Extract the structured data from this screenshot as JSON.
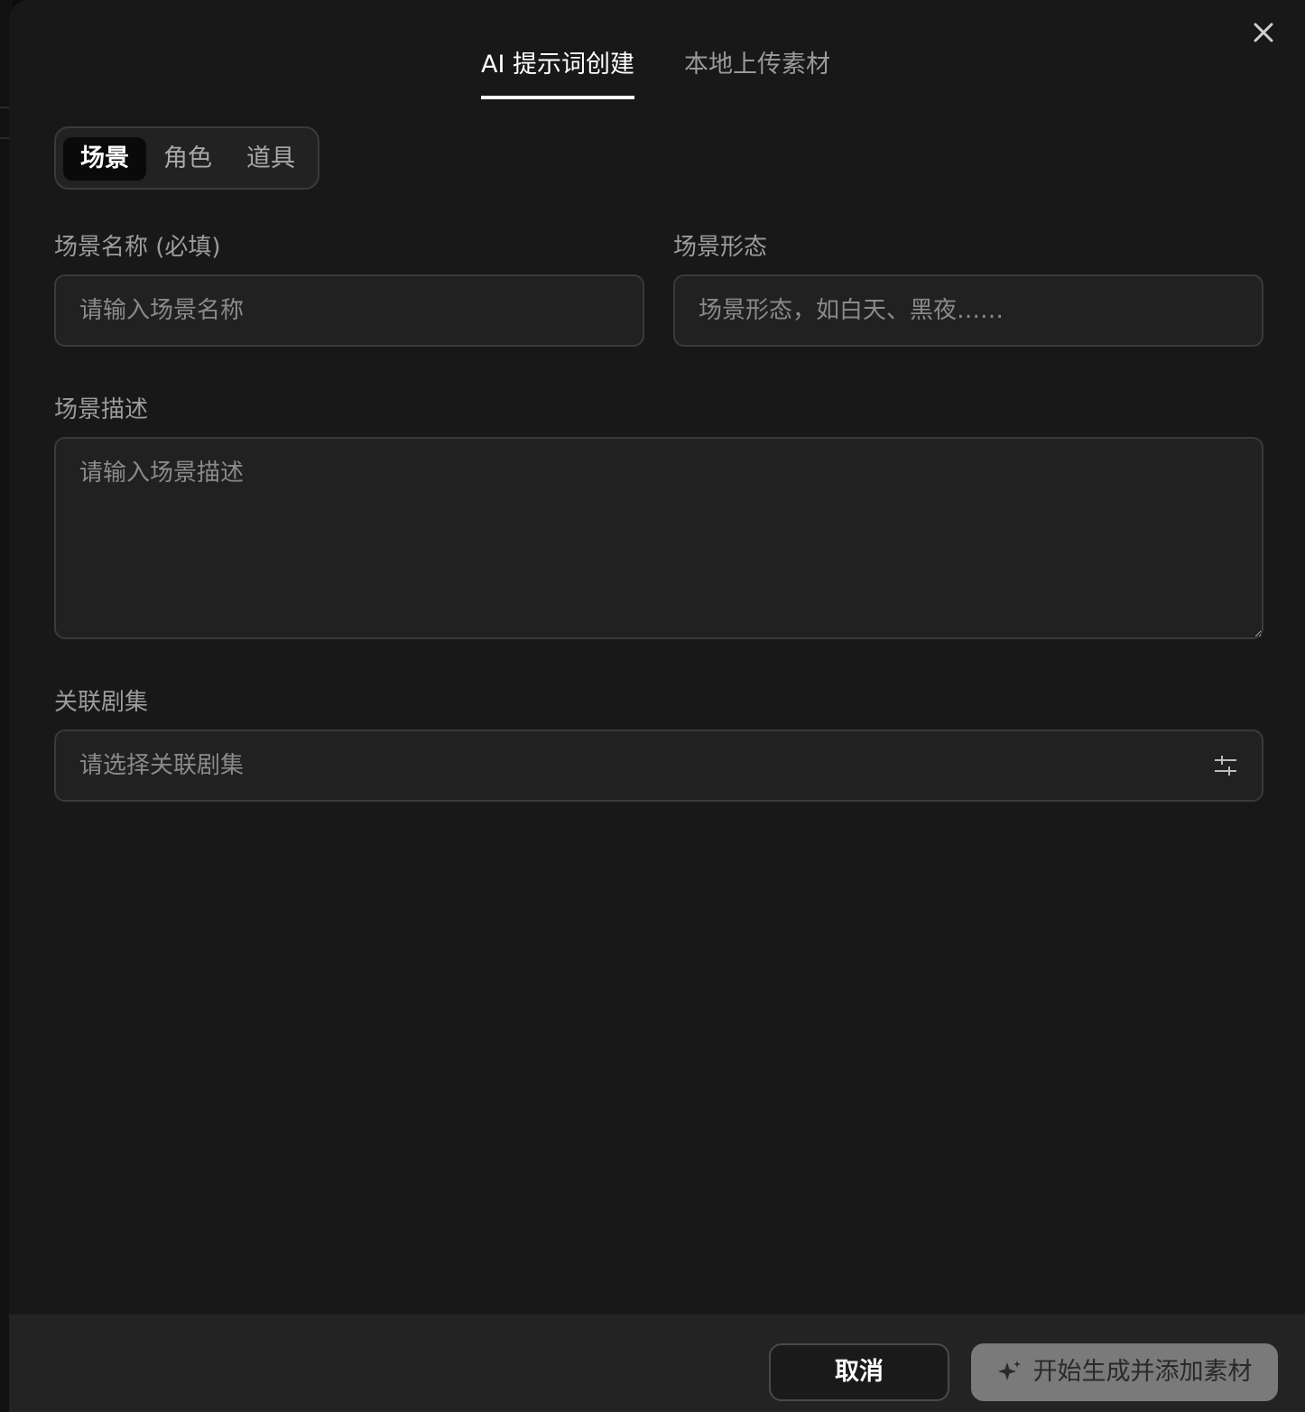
{
  "tabs": {
    "ai_create": "AI 提示词创建",
    "local_upload": "本地上传素材"
  },
  "segments": [
    {
      "label": "场景",
      "active": true
    },
    {
      "label": "角色",
      "active": false
    },
    {
      "label": "道具",
      "active": false
    }
  ],
  "form": {
    "scene_name": {
      "label": "场景名称 (必填)",
      "placeholder": "请输入场景名称",
      "value": ""
    },
    "scene_form": {
      "label": "场景形态",
      "placeholder": "场景形态，如白天、黑夜……",
      "value": ""
    },
    "scene_description": {
      "label": "场景描述",
      "placeholder": "请输入场景描述",
      "value": ""
    },
    "related_episodes": {
      "label": "关联剧集",
      "placeholder": "请选择关联剧集"
    }
  },
  "footer": {
    "cancel_label": "取消",
    "generate_label": "开始生成并添加素材"
  },
  "icons": {
    "close": "close-icon",
    "filter": "filter-sliders-icon",
    "sparkle": "sparkle-icon"
  },
  "colors": {
    "modal_bg": "#181818",
    "field_bg": "#212121",
    "active_tab": "#ffffff",
    "disabled_button": "#7a7a7a"
  }
}
